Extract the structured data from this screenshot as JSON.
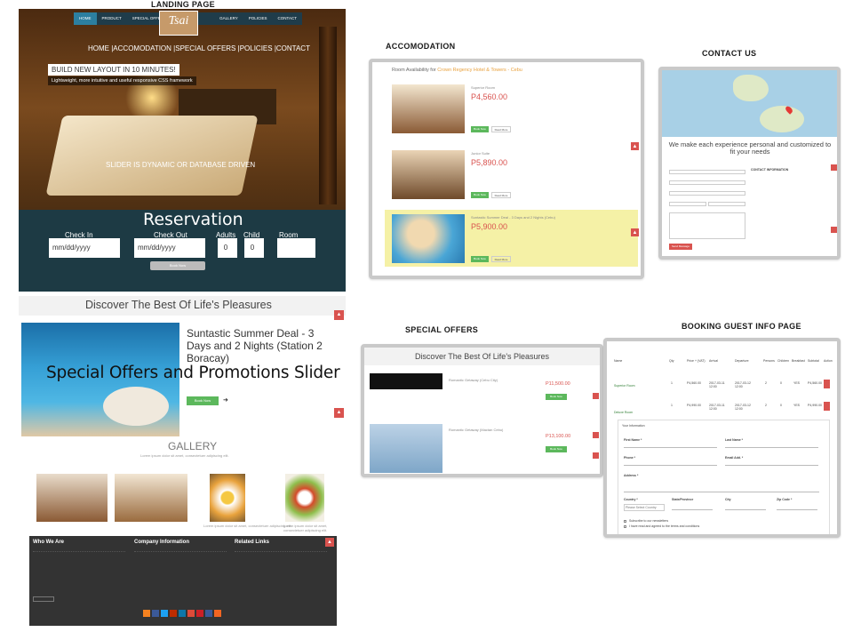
{
  "captions": {
    "landing": "LANDING PAGE",
    "accomodation": "ACCOMODATION",
    "contact": "CONTACT US",
    "special_offers": "SPECIAL OFFERS",
    "booking": "BOOKING GUEST INFO PAGE"
  },
  "landing": {
    "nav": [
      "HOME",
      "PRODUCT",
      "SPECIAL OFFERS",
      "",
      "GALLERY",
      "POLICIES",
      "CONTACT"
    ],
    "logo_text": "Tsai",
    "menu_line": "HOME |ACCOMODATION |SPECIAL OFFERS |POLICIES |CONTACT",
    "promo_title": "BUILD NEW LAYOUT IN 10 MINUTES!",
    "promo_sub": "Lightweight, more intuitive and useful responsive CSS framework",
    "slider_note": "SLIDER IS DYNAMIC OR DATABASE DRIVEN",
    "reservation": {
      "title": "Reservation",
      "checkin_label": "Check In",
      "checkout_label": "Check Out",
      "adults_label": "Adults",
      "child_label": "Child",
      "room_label": "Room",
      "checkin_value": "mm/dd/yyyy",
      "checkout_value": "mm/dd/yyyy",
      "adults_value": "0",
      "child_value": "0",
      "button": "Book Now"
    },
    "discover_title": "Discover The Best Of Life's Pleasures",
    "deal_title": "Suntastic Summer Deal - 3 Days and 2 Nights (Station 2 Boracay)",
    "book_now": "Book Now",
    "slider_overlay": "Special Offers and Promotions Slider",
    "gallery_title": "GALLERY",
    "gallery_sub": "Lorem ipsum dolor sit amet, consectetuer adipiscing elit.",
    "gallery_captions": [
      "Lorem ipsum dolor sit amet, consectetuer adipiscing elit.",
      "Lorem ipsum dolor sit amet, consectetuer adipiscing elit."
    ]
  },
  "footer": {
    "col1_title": "Who We Are",
    "col2_title": "Company Information",
    "col3_title": "Related Links",
    "social_colors": [
      "#f58220",
      "#3b5998",
      "#1da1f2",
      "#bd2c00",
      "#0e76a8",
      "#dd4b39",
      "#cb2027",
      "#3b5998",
      "#f26522"
    ]
  },
  "accomodation": {
    "heading_prefix": "Room Availability for",
    "heading_hotel": "Crown Regency Hotel & Towers - Cebu",
    "rooms": [
      {
        "name": "Superior Room",
        "price": "P4,560.00"
      },
      {
        "name": "Junior Suite",
        "price": "P5,890.00"
      },
      {
        "name": "Suntastic Summer Deal - 3 Days and 2 Nights (Cebu)",
        "price": "P5,900.00"
      }
    ],
    "book_label": "Book Now",
    "more_label": "Read More"
  },
  "contact": {
    "message": "We make each experience personal and customized to fit your needs",
    "info_title": "CONTACT INFORMATION",
    "button": "Send Message"
  },
  "offers": {
    "title": "Discover The Best Of Life's Pleasures",
    "items": [
      {
        "name": "Romantic Getaway (Cebu City)",
        "price": "P11,500.00"
      },
      {
        "name": "Romantic Getaway (Mactan Cebu)",
        "price": "P13,100.00"
      }
    ],
    "book_label": "Book Now"
  },
  "booking": {
    "columns": [
      "Name",
      "Qty",
      "Price + (VAT)",
      "Arrival",
      "Departure",
      "Persons",
      "Children",
      "Breakfast",
      "Subtotal",
      "Action"
    ],
    "rows": [
      {
        "name": "Superior Room",
        "qty": "1",
        "price": "P4,560.00",
        "arrival": "2017-03-11 12:00",
        "departure": "2017-03-12 12:00",
        "persons": "2",
        "children": "0",
        "breakfast": "YES",
        "subtotal": "P4,560.00"
      },
      {
        "name": "Deluxe Room",
        "qty": "1",
        "price": "P4,990.00",
        "arrival": "2017-03-11 12:00",
        "departure": "2017-03-12 12:00",
        "persons": "2",
        "children": "0",
        "breakfast": "YES",
        "subtotal": "P4,990.00"
      }
    ],
    "form_title": "Your Information",
    "first_name": "First Name *",
    "last_name": "Last Name *",
    "phone": "Phone *",
    "email": "Email Add. *",
    "address": "Address *",
    "country": "Country *",
    "country_value": "Please Select Country",
    "state": "State/Province",
    "city": "City",
    "zip": "Zip Code *",
    "newsletter": "Subscribe to our newsletters",
    "terms": "I have read and agreed to the terms and conditions"
  }
}
